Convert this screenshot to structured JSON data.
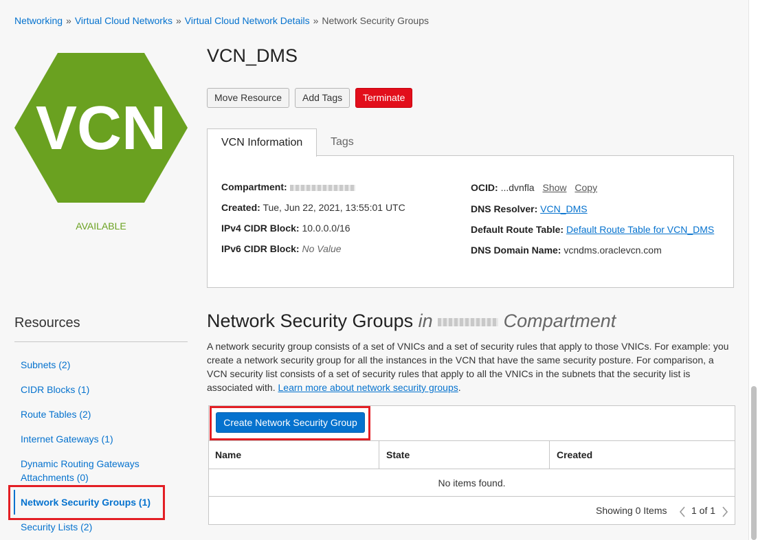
{
  "breadcrumb": {
    "items": [
      "Networking",
      "Virtual Cloud Networks",
      "Virtual Cloud Network Details"
    ],
    "current": "Network Security Groups",
    "separator": "»"
  },
  "resource": {
    "icon_text": "VCN",
    "icon_color": "#6aa120",
    "status": "AVAILABLE",
    "title": "VCN_DMS"
  },
  "actions": {
    "move": "Move Resource",
    "tags": "Add Tags",
    "terminate": "Terminate"
  },
  "tabs": {
    "info": "VCN Information",
    "tags": "Tags"
  },
  "vcn_info": {
    "compartment_label": "Compartment:",
    "created_label": "Created:",
    "created_value": "Tue, Jun 22, 2021, 13:55:01 UTC",
    "ipv4_label": "IPv4 CIDR Block:",
    "ipv4_value": "10.0.0.0/16",
    "ipv6_label": "IPv6 CIDR Block:",
    "ipv6_value": "No Value",
    "ocid_label": "OCID:",
    "ocid_value": "...dvnfla",
    "ocid_show": "Show",
    "ocid_copy": "Copy",
    "dns_resolver_label": "DNS Resolver:",
    "dns_resolver_value": "VCN_DMS",
    "route_table_label": "Default Route Table:",
    "route_table_value": "Default Route Table for VCN_DMS",
    "dns_domain_label": "DNS Domain Name:",
    "dns_domain_value": "vcndms.oraclevcn.com"
  },
  "resources": {
    "title": "Resources",
    "items": [
      "Subnets (2)",
      "CIDR Blocks (1)",
      "Route Tables (2)",
      "Internet Gateways (1)",
      "Dynamic Routing Gateways Attachments (0)",
      "Network Security Groups (1)",
      "Security Lists (2)"
    ]
  },
  "nsg": {
    "title": "Network Security Groups",
    "in_word": "in",
    "compartment_word": "Compartment",
    "description": "A network security group consists of a set of VNICs and a set of security rules that apply to those VNICs. For example: you create a network security group for all the instances in the VCN that have the same security posture. For comparison, a VCN security list consists of a set of security rules that apply to all the VNICs in the subnets that the security list is associated with.",
    "learn_more": "Learn more about network security groups",
    "create_button": "Create Network Security Group",
    "columns": [
      "Name",
      "State",
      "Created"
    ],
    "empty_text": "No items found.",
    "showing": "Showing 0 Items",
    "page": "1 of 1"
  }
}
